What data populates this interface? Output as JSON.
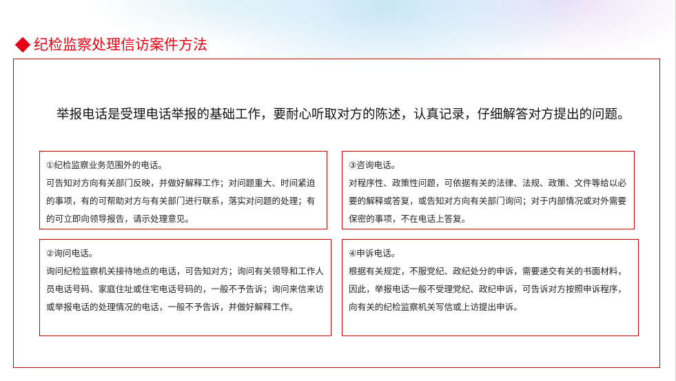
{
  "title": "纪检监察处理信访案件方法",
  "intro": "举报电话是受理电话举报的基础工作，要耐心听取对方的陈述，认真记录，仔细解答对方提出的问题。",
  "boxes": [
    {
      "title": "①纪检监察业务范围外的电话。",
      "body": "可告知对方向有关部门反映，并做好解释工作；对问题重大、时间紧迫的事项，有的可帮助对方与有关部门进行联系，落实对问题的处理；有的可立即向领导报告，请示处理意见。"
    },
    {
      "title": "②询问电话。",
      "body": "询问纪检监察机关接待地点的电话，可告知对方；询问有关领导和工作人员电话号码、家庭住址或住宅电话号码的，一般不予告诉；询问来信来访或举报电话的处理情况的电话，一般不予告诉，并做好解释工作。"
    },
    {
      "title": "③咨询电话。",
      "body": "对程序性、政策性问题，可依据有关的法律、法规、政策、文件等给以必要的解释或答复，或告知对方向有关部门询问；对于内部情况或对外需要保密的事项，不在电话上答复。"
    },
    {
      "title": "④申诉电话。",
      "body": "根据有关规定，不服党纪、政纪处分的申诉，需要递交有关的书面材料，因此，举报电话一般不受理党纪、政纪申诉，可告诉对方按照申诉程序，向有关的纪检监察机关写信或上访提出申诉。"
    }
  ],
  "colors": {
    "accent": "#e60012",
    "border": "#c00000"
  }
}
